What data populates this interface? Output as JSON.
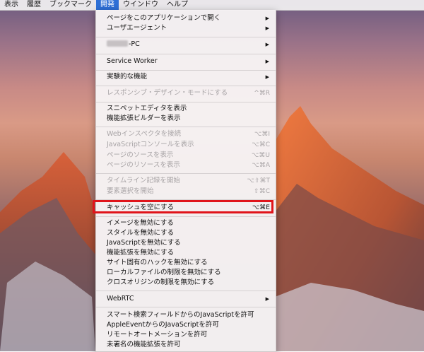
{
  "menubar": {
    "items": [
      "表示",
      "履歴",
      "ブックマーク",
      "開発",
      "ウインドウ",
      "ヘルプ"
    ],
    "active": "開発"
  },
  "menu": {
    "open_with": "ページをこのアプリケーションで開く",
    "user_agent": "ユーザエージェント",
    "device_suffix": "-PC",
    "service_worker": "Service Worker",
    "experimental": "実験的な機能",
    "responsive": {
      "label": "レスポンシブ・デザイン・モードにする",
      "shortcut": "^⌘R"
    },
    "snippet_editor": "スニペットエディタを表示",
    "extension_builder": "機能拡張ビルダーを表示",
    "web_inspector": {
      "label": "Webインスペクタを接続",
      "shortcut": "⌥⌘I"
    },
    "js_console": {
      "label": "JavaScriptコンソールを表示",
      "shortcut": "⌥⌘C"
    },
    "page_source": {
      "label": "ページのソースを表示",
      "shortcut": "⌥⌘U"
    },
    "page_resources": {
      "label": "ページのリソースを表示",
      "shortcut": "⌥⌘A"
    },
    "timeline": {
      "label": "タイムライン記録を開始",
      "shortcut": "⌥⇧⌘T"
    },
    "element_select": {
      "label": "要素選択を開始",
      "shortcut": "⇧⌘C"
    },
    "empty_caches": {
      "label": "キャッシュを空にする",
      "shortcut": "⌥⌘E"
    },
    "disable_images": "イメージを無効にする",
    "disable_styles": "スタイルを無効にする",
    "disable_js": "JavaScriptを無効にする",
    "disable_extensions": "機能拡張を無効にする",
    "disable_site_hacks": "サイト固有のハックを無効にする",
    "disable_local_file": "ローカルファイルの制限を無効にする",
    "disable_cors": "クロスオリジンの制限を無効にする",
    "webrtc": "WebRTC",
    "allow_smart_search_js": "スマート検索フィールドからのJavaScriptを許可",
    "allow_appleevent_js": "AppleEventからのJavaScriptを許可",
    "allow_remote_automation": "リモートオートメーションを許可",
    "allow_unsigned_extensions": "未署名の機能拡張を許可"
  }
}
